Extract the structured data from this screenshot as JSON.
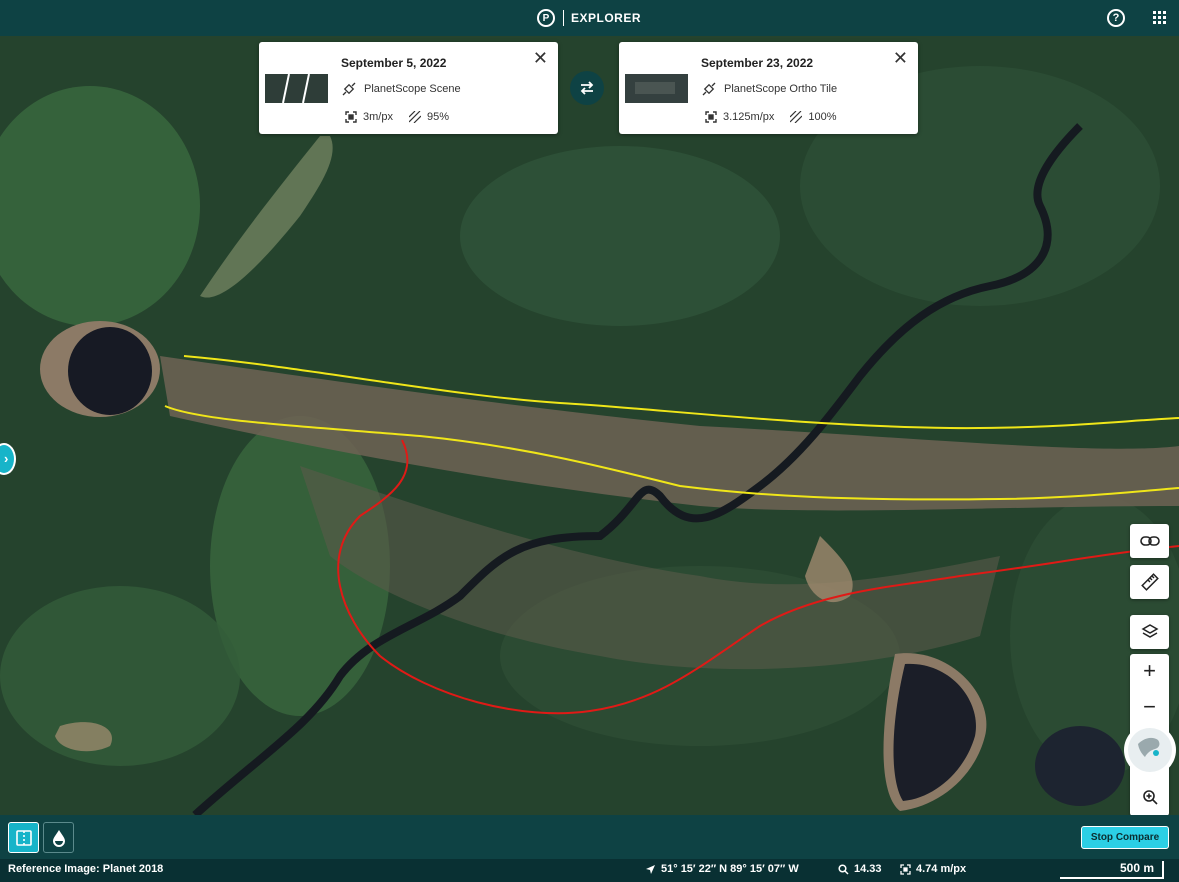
{
  "app": {
    "logo_letter": "P",
    "title": "EXPLORER"
  },
  "header": {
    "help_icon": "help-circle-icon",
    "apps_icon": "apps-grid-icon",
    "help_glyph": "?"
  },
  "compare": {
    "left": {
      "date": "September 5, 2022",
      "source": "PlanetScope Scene",
      "resolution": "3m/px",
      "coverage": "95%",
      "close_glyph": "✕"
    },
    "right": {
      "date": "September 23, 2022",
      "source": "PlanetScope Ortho Tile",
      "resolution": "3.125m/px",
      "coverage": "100%",
      "close_glyph": "✕"
    },
    "swap_icon": "swap-arrows-icon"
  },
  "map_tools": {
    "zoom_in": "+",
    "zoom_out": "−"
  },
  "bottom": {
    "stop_label": "Stop Compare"
  },
  "status": {
    "reference": "Reference Image: Planet 2018",
    "coordinates": "51° 15′ 22″ N 89° 15′ 07″ W",
    "zoom": "14.33",
    "resolution": "4.74 m/px",
    "scale": "500 m"
  },
  "colors": {
    "header": "#0e4244",
    "accent": "#2bcfe5",
    "yellow_line": "#f0e619",
    "red_line": "#e01a16"
  }
}
